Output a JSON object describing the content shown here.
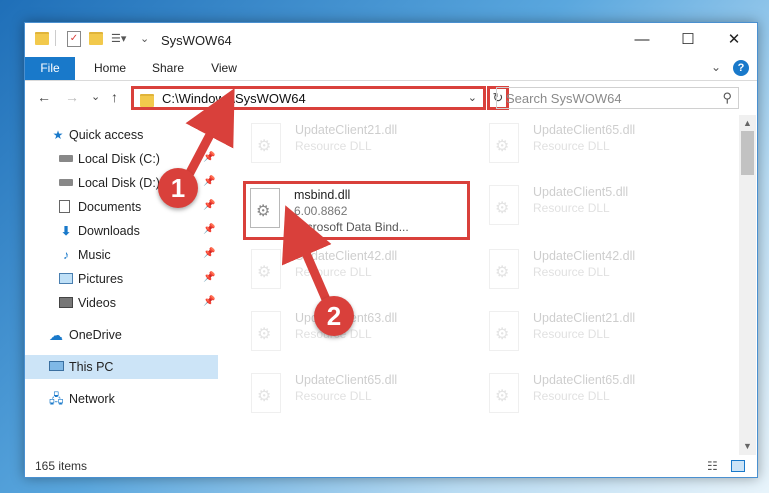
{
  "window": {
    "title": "SysWOW64"
  },
  "window_controls": {
    "minimize": "—",
    "maximize": "☐",
    "close": "✕"
  },
  "ribbon": {
    "tabs": [
      "File",
      "Home",
      "Share",
      "View"
    ],
    "collapse_glyph": "⌄",
    "help_glyph": "?"
  },
  "address": {
    "path": "C:\\Windows\\SysWOW64",
    "refresh_glyph": "↻",
    "dropdown_glyph": "⌄"
  },
  "search": {
    "placeholder": "Search SysWOW64"
  },
  "nav_buttons": {
    "back": "←",
    "forward": "→",
    "recent": "⌄",
    "up": "↑"
  },
  "sidebar": {
    "items": [
      {
        "label": "Quick access",
        "icon": "star-icon",
        "pinned": false
      },
      {
        "label": "Local Disk (C:)",
        "icon": "drive-icon",
        "pinned": true
      },
      {
        "label": "Local Disk (D:)",
        "icon": "drive-icon",
        "pinned": true
      },
      {
        "label": "Documents",
        "icon": "documents-icon",
        "pinned": true
      },
      {
        "label": "Downloads",
        "icon": "downloads-icon",
        "pinned": true
      },
      {
        "label": "Music",
        "icon": "music-icon",
        "pinned": true
      },
      {
        "label": "Pictures",
        "icon": "pictures-icon",
        "pinned": true
      },
      {
        "label": "Videos",
        "icon": "videos-icon",
        "pinned": true
      },
      {
        "label": "OneDrive",
        "icon": "cloud-icon",
        "pinned": false
      },
      {
        "label": "This PC",
        "icon": "computer-icon",
        "pinned": false
      },
      {
        "label": "Network",
        "icon": "network-icon",
        "pinned": false
      }
    ],
    "pin_glyph": "📌"
  },
  "files": {
    "highlighted": {
      "name": "msbind.dll",
      "version": "6.00.8862",
      "description": "Microsoft Data Bind..."
    },
    "faded": [
      {
        "name": "UpdateClient21.dll",
        "type": "Resource DLL"
      },
      {
        "name": "UpdateClient65.dll",
        "type": "Resource DLL"
      },
      {
        "name": "UpdateClient5.dll",
        "type": "Resource DLL"
      },
      {
        "name": "UpdateClient42.dll",
        "type": "Resource DLL"
      },
      {
        "name": "UpdateClient42.dll",
        "type": "Resource DLL"
      },
      {
        "name": "UpdateClient63.dll",
        "type": "Resource DLL"
      },
      {
        "name": "UpdateClient21.dll",
        "type": "Resource DLL"
      },
      {
        "name": "UpdateClient65.dll",
        "type": "Resource DLL"
      },
      {
        "name": "UpdateClient65.dll",
        "type": "Resource DLL"
      }
    ]
  },
  "status": {
    "item_count": "165 items"
  },
  "callouts": {
    "step1": "1",
    "step2": "2"
  },
  "colors": {
    "accent": "#1979ca",
    "highlight": "#d9403b",
    "selected": "#cce4f7"
  }
}
